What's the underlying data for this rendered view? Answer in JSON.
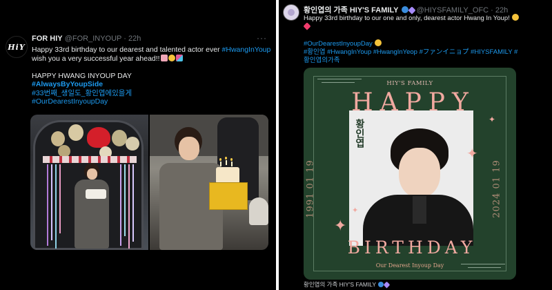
{
  "tweet_left": {
    "avatar_text": "HiY",
    "name": "FOR HIY",
    "handle": "@FOR_INYOUP",
    "separator": "·",
    "time": "22h",
    "more": "···",
    "line1_text": "Happy 33rd birthday to our dearest and talented actor ever ",
    "line1_hashtag": "#HwangInYoup",
    "line2_text": "wish you a very successful year ahead!!",
    "line3_text": "HAPPY HWANG INYOUP DAY",
    "hashtag_1": "#AlwaysByYoupSide",
    "hashtag_2": "#33번째_생일도_황인엽에있을게",
    "hashtag_3": "#OurDearestInyoupDay"
  },
  "tweet_right": {
    "name": "황인엽의 가족 HIY'S FAMILY",
    "handle": "@HIYSFAMILY_OFC",
    "separator": "·",
    "time": "22h",
    "body_line1": "Happy 33rd birthday to our one and only, dearest actor Hwang In Youp!",
    "hashtag_day": "#OurDearestInyoupDay",
    "hashtags_line1": "#황인엽 #HwangInYoup #HwangInYeop #ファンイニョプ #HIYSFAMILY #",
    "hashtags_line2": "황인엽의가족",
    "poster": {
      "brand": "HIY'S FAMILY",
      "happy": "HAPPY",
      "korean_name": "황인엽",
      "date_left": "1991 01 19",
      "date_right": "2024 01 19",
      "birthday": "BIRTHDAY",
      "subtitle": "Our Dearest Inyoup Day"
    },
    "footer_handle": "황인엽의 가족 HIY'S FAMILY"
  },
  "colors": {
    "background": "#000000",
    "link": "#1d9bf0",
    "muted": "#71767b",
    "poster_green": "#23422c",
    "poster_pink": "#f1a9a0"
  }
}
